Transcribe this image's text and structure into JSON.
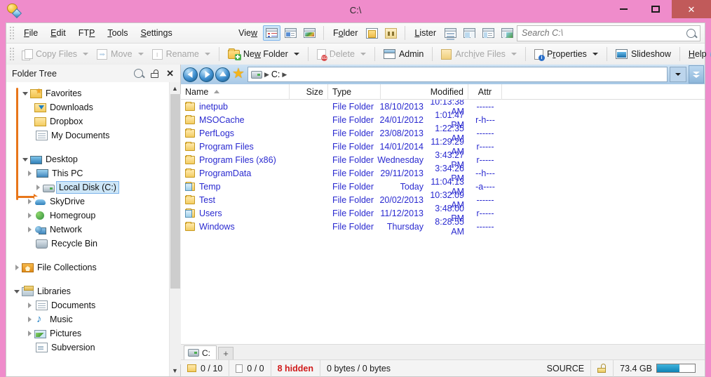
{
  "window": {
    "title": "C:\\",
    "app_icon": "opus-logo-icon",
    "accent_pink": "#ef8ccb",
    "close_red": "#c15a5a",
    "controls": {
      "minimize": "–",
      "maximize": "□",
      "close": "✕"
    }
  },
  "menubar": {
    "items": [
      {
        "label": "File",
        "accel": "F"
      },
      {
        "label": "Edit",
        "accel": "E"
      },
      {
        "label": "FTP",
        "accel": "P"
      },
      {
        "label": "Tools",
        "accel": "T"
      },
      {
        "label": "Settings",
        "accel": "S"
      }
    ],
    "view_label": "View",
    "view_modes": [
      {
        "name": "details-view-icon",
        "active": true
      },
      {
        "name": "list-view-icon",
        "active": false
      },
      {
        "name": "thumbnails-view-icon",
        "active": false
      }
    ],
    "folder_label": "Folder",
    "folder_buttons": [
      {
        "name": "folder-formats-icon"
      },
      {
        "name": "folder-lock-icon"
      }
    ],
    "lister_label": "Lister",
    "lister_buttons": [
      {
        "name": "single-pane-icon"
      },
      {
        "name": "dual-vertical-icon"
      },
      {
        "name": "tree-pane-icon"
      },
      {
        "name": "viewer-pane-icon"
      }
    ]
  },
  "search": {
    "placeholder": "Search C:\\",
    "value": "",
    "icon": "search-icon"
  },
  "toolbar": {
    "buttons": [
      {
        "label": "Copy Files",
        "icon": "copy-files-icon",
        "disabled": true,
        "dropdown": true
      },
      {
        "label": "Move",
        "icon": "move-icon",
        "disabled": true,
        "dropdown": true
      },
      {
        "label": "Rename",
        "icon": "rename-icon",
        "disabled": true,
        "dropdown": true
      },
      {
        "label": "New Folder",
        "icon": "new-folder-icon",
        "disabled": false,
        "dropdown": true
      },
      {
        "label": "Delete",
        "icon": "delete-icon",
        "disabled": true,
        "dropdown": true
      },
      {
        "label": "Admin",
        "icon": "admin-icon",
        "disabled": false,
        "dropdown": false
      },
      {
        "label": "Archive Files",
        "icon": "archive-icon",
        "disabled": true,
        "dropdown": true
      },
      {
        "label": "Properties",
        "icon": "properties-icon",
        "disabled": false,
        "dropdown": true
      },
      {
        "label": "Slideshow",
        "icon": "slideshow-icon",
        "disabled": false,
        "dropdown": false
      },
      {
        "label": "Help",
        "icon": "help-icon",
        "disabled": false,
        "dropdown": false
      }
    ]
  },
  "tree_panel": {
    "title": "Folder Tree",
    "tools": [
      {
        "name": "search-icon"
      },
      {
        "name": "unlock-padlock-icon"
      },
      {
        "name": "close-icon"
      }
    ],
    "items": [
      {
        "label": "Favorites",
        "icon": "favorites-folder-icon",
        "indent": 0,
        "expander": "down",
        "selected": false
      },
      {
        "label": "Downloads",
        "icon": "downloads-folder-icon",
        "indent": 1,
        "expander": "none",
        "selected": false
      },
      {
        "label": "Dropbox",
        "icon": "folder-icon",
        "indent": 1,
        "expander": "none",
        "selected": false
      },
      {
        "label": "My Documents",
        "icon": "documents-icon",
        "indent": 1,
        "expander": "none",
        "selected": false
      },
      {
        "label": "Desktop",
        "icon": "desktop-icon",
        "indent": 0,
        "expander": "down",
        "selected": false
      },
      {
        "label": "This PC",
        "icon": "this-pc-icon",
        "indent": 1,
        "expander": "right",
        "selected": false
      },
      {
        "label": "Local Disk (C:)",
        "icon": "drive-icon",
        "indent": 2,
        "expander": "right",
        "selected": true
      },
      {
        "label": "SkyDrive",
        "icon": "skydrive-cloud-icon",
        "indent": 1,
        "expander": "right",
        "selected": false
      },
      {
        "label": "Homegroup",
        "icon": "homegroup-icon",
        "indent": 1,
        "expander": "right",
        "selected": false
      },
      {
        "label": "Network",
        "icon": "network-icon",
        "indent": 1,
        "expander": "right",
        "selected": false
      },
      {
        "label": "Recycle Bin",
        "icon": "recycle-bin-icon",
        "indent": 1,
        "expander": "none",
        "selected": false
      },
      {
        "label": "File Collections",
        "icon": "file-collections-icon",
        "indent": 0,
        "expander": "right",
        "selected": false
      },
      {
        "label": "Libraries",
        "icon": "libraries-icon",
        "indent": 0,
        "expander": "down",
        "selected": false
      },
      {
        "label": "Documents",
        "icon": "documents-icon",
        "indent": 1,
        "expander": "right",
        "selected": false
      },
      {
        "label": "Music",
        "icon": "music-icon",
        "indent": 1,
        "expander": "right",
        "selected": false
      },
      {
        "label": "Pictures",
        "icon": "pictures-icon",
        "indent": 1,
        "expander": "right",
        "selected": false
      },
      {
        "label": "Subversion",
        "icon": "subversion-icon",
        "indent": 1,
        "expander": "none",
        "selected": false
      }
    ]
  },
  "navbar": {
    "back": "back-icon",
    "forward": "forward-icon",
    "up": "up-icon",
    "favorites": "favorites-star-icon",
    "breadcrumb": {
      "drive_icon": "drive-icon",
      "parts": [
        "C:"
      ]
    },
    "dropdown": "chevron-down-icon",
    "double_chevron": "double-chevron-down-icon"
  },
  "file_list": {
    "columns": [
      {
        "key": "name",
        "label": "Name",
        "sorted": "asc"
      },
      {
        "key": "size",
        "label": "Size"
      },
      {
        "key": "type",
        "label": "Type"
      },
      {
        "key": "mod",
        "label": "Modified"
      },
      {
        "key": "attr",
        "label": "Attr"
      }
    ],
    "rows": [
      {
        "name": "inetpub",
        "icon": "folder-icon",
        "size": "",
        "type": "File Folder",
        "date": "18/10/2013",
        "time": "10:13:38 AM",
        "attr": "------"
      },
      {
        "name": "MSOCache",
        "icon": "folder-icon",
        "size": "",
        "type": "File Folder",
        "date": "24/01/2012",
        "time": "1:01:47 PM",
        "attr": "r-h---"
      },
      {
        "name": "PerfLogs",
        "icon": "folder-icon",
        "size": "",
        "type": "File Folder",
        "date": "23/08/2013",
        "time": "1:22:35 AM",
        "attr": "------"
      },
      {
        "name": "Program Files",
        "icon": "folder-icon",
        "size": "",
        "type": "File Folder",
        "date": "14/01/2014",
        "time": "11:29:29 AM",
        "attr": "r-----"
      },
      {
        "name": "Program Files (x86)",
        "icon": "folder-icon",
        "size": "",
        "type": "File Folder",
        "date": "Wednesday",
        "time": "3:43:27 PM",
        "attr": "r-----"
      },
      {
        "name": "ProgramData",
        "icon": "folder-icon",
        "size": "",
        "type": "File Folder",
        "date": "29/11/2013",
        "time": "3:34:26 PM",
        "attr": "--h---"
      },
      {
        "name": "Temp",
        "icon": "junction-folder-icon",
        "size": "",
        "type": "File Folder",
        "date": "Today",
        "time": "11:04:13 AM",
        "attr": "-a----"
      },
      {
        "name": "Test",
        "icon": "folder-icon",
        "size": "",
        "type": "File Folder",
        "date": "20/02/2013",
        "time": "10:32:09 AM",
        "attr": "------"
      },
      {
        "name": "Users",
        "icon": "junction-folder-icon",
        "size": "",
        "type": "File Folder",
        "date": "11/12/2013",
        "time": "3:48:00 PM",
        "attr": "r-----"
      },
      {
        "name": "Windows",
        "icon": "folder-icon",
        "size": "",
        "type": "File Folder",
        "date": "Thursday",
        "time": "8:28:55 AM",
        "attr": "------"
      }
    ]
  },
  "tabbar": {
    "tabs": [
      {
        "label": "C:",
        "icon": "drive-icon",
        "active": true
      }
    ],
    "new_tab": "+"
  },
  "statusbar": {
    "folders_count": "0 / 10",
    "files_count": "0 / 0",
    "hidden": "8 hidden",
    "bytes": "0 bytes / 0 bytes",
    "source_label": "SOURCE",
    "lock_icon": "unlock-padlock-icon",
    "free_space": "73.4 GB",
    "capacity_percent": 60
  }
}
